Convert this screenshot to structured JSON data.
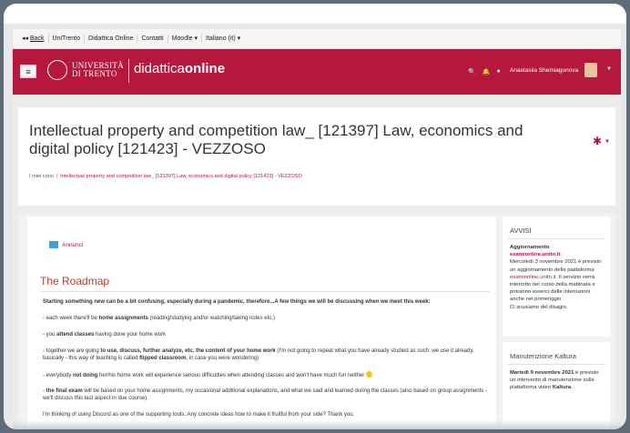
{
  "topnav": {
    "back": "Back",
    "items": [
      "UniTrento",
      "Didattica Online",
      "Contatti",
      "Moodle",
      "Italiano (it)"
    ]
  },
  "header": {
    "uni_line1": "UNIVERSITÀ",
    "uni_line2": "DI TRENTO",
    "brand_light": "didattica",
    "brand_bold": "online",
    "user": "Anastasiia Shemiagonova"
  },
  "course": {
    "title": "Intellectual property and competition law_ [121397] Law, economics and digital policy [121423] - VEZZOSO",
    "breadcrumb_home": "I miei corsi",
    "breadcrumb_course": "Intellectual property and competition law_ [121397] Law, economics and digital policy [121423] - VEZZOSO"
  },
  "main": {
    "announcements": "Annunci",
    "roadmap_title": "The Roadmap",
    "intro": "Starting something new can be a bit confusing, especially during a pandemic, therefore...A few things we will be discussing when we meet this week:",
    "p1_a": "- each week there'll be ",
    "p1_b": "home assignments",
    "p1_c": " (reading/studying and/or watching/taking notes etc.)",
    "p2_a": "- you ",
    "p2_b": "attend classes",
    "p2_c": " having done your home work",
    "p3_a": "- together we are going ",
    "p3_b": "to use, discuss, further analyze, etc. the content of your home work",
    "p3_c": " (I'm not going to repeat what you have already studied as such: we use it already, basically - this way of teaching is called ",
    "p3_d": "flipped classroom",
    "p3_e": ", in case you were wondering)",
    "p4_a": "- everybody ",
    "p4_b": "not doing",
    "p4_c": " her/his home work will experience serious difficulties when attending classes and won't have much fun neither ",
    "p5_a": "- ",
    "p5_b": "the final exam",
    "p5_c": " will be based on your home assignments, my occasional additional explanations, and what we said and learned during the classes (also based on group assignments - we'll discuss this last aspect in due course).",
    "p6": "I'm thinking of using Discord as one of the supporting tools..Any concrete ideas how to make it fruitful from your side? Thank you."
  },
  "avvisi": {
    "title": "AVVISI",
    "heading": "Aggiornamento",
    "link": "esamionline.unitn.it",
    "text1": "Mercoledì 3 novembre 2021 è previsto un aggiornamento della piattaforma ",
    "link2": "esamionline.unitn.it",
    "text2": ". Il servizio verrà interrotto nel corso della mattinata e potranno esserci delle interruzioni anche nel pomeriggio.",
    "text3": "Ci scusiamo del disagio."
  },
  "kaltura": {
    "title": "Manutenzione Kaltura",
    "date": "Martedì 9 novembre 2021",
    "text": " è previsto un intervento di manutenzione sulla piattaforma video ",
    "bold": "Kaltura",
    "tail": "."
  }
}
